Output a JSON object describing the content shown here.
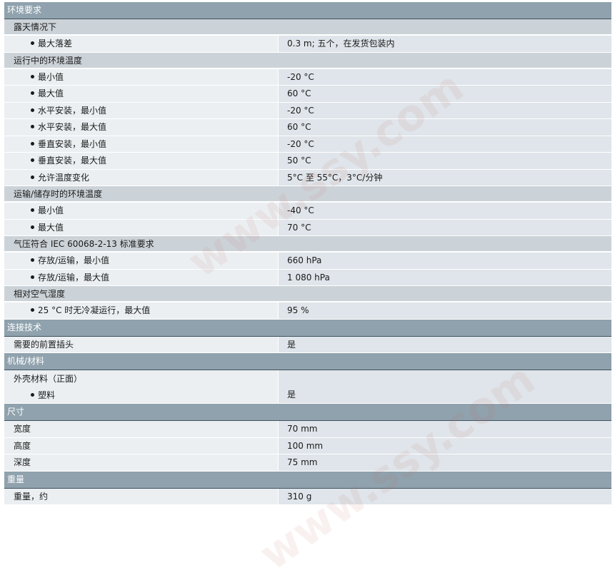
{
  "watermark": "www.ssy.com",
  "colors": {
    "section_bg": "#8fa2ad",
    "sub_bg": "#ccd3d8",
    "label_bg": "#ebeff2",
    "value_bg": "#dfe5ea"
  },
  "sections": {
    "env": {
      "title": "环境要求",
      "outdoor": {
        "title": "露天情况下",
        "drop_label": "最大落差",
        "drop_value": "0.3 m; 五个，在发货包装内"
      },
      "operating": {
        "title": "运行中的环境温度",
        "rows": [
          {
            "label": "最小值",
            "value": "-20 °C"
          },
          {
            "label": "最大值",
            "value": "60 °C"
          },
          {
            "label": "水平安装，最小值",
            "value": "-20 °C"
          },
          {
            "label": "水平安装，最大值",
            "value": "60 °C"
          },
          {
            "label": "垂直安装，最小值",
            "value": "-20 °C"
          },
          {
            "label": "垂直安装，最大值",
            "value": "50 °C"
          },
          {
            "label": "允许温度变化",
            "value": "5°C 至 55°C，3°C/分钟"
          }
        ]
      },
      "storage": {
        "title": "运输/储存时的环境温度",
        "rows": [
          {
            "label": "最小值",
            "value": "-40 °C"
          },
          {
            "label": "最大值",
            "value": "70 °C"
          }
        ]
      },
      "pressure": {
        "title": "气压符合 IEC 60068-2-13 标准要求",
        "rows": [
          {
            "label": "存放/运输，最小值",
            "value": "660 hPa"
          },
          {
            "label": "存放/运输，最大值",
            "value": "1 080 hPa"
          }
        ]
      },
      "humidity": {
        "title": "相对空气湿度",
        "rows": [
          {
            "label": "25 °C 时无冷凝运行，最大值",
            "value": "95 %"
          }
        ]
      }
    },
    "connect": {
      "title": "连接技术",
      "label": "需要的前置插头",
      "value": "是"
    },
    "mech": {
      "title": "机械/材料",
      "label": "外壳材料（正面）",
      "sub_label": "塑料",
      "value": "是"
    },
    "dims": {
      "title": "尺寸",
      "rows": [
        {
          "label": "宽度",
          "value": "70 mm"
        },
        {
          "label": "高度",
          "value": "100 mm"
        },
        {
          "label": "深度",
          "value": "75 mm"
        }
      ]
    },
    "weight": {
      "title": "重量",
      "label": "重量，约",
      "value": "310 g"
    }
  }
}
